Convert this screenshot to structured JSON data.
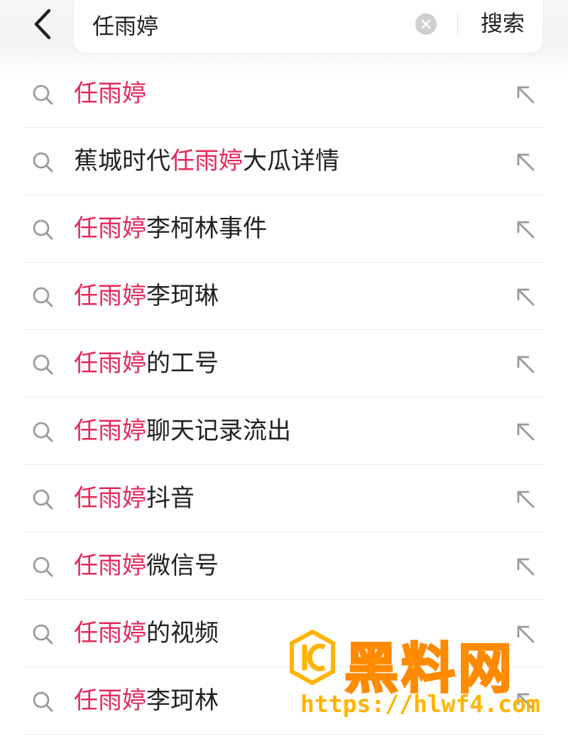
{
  "header": {
    "search_value": "任雨婷",
    "search_button_label": "搜索"
  },
  "suggestions": [
    {
      "before": "",
      "highlight": "任雨婷",
      "after": ""
    },
    {
      "before": "蕉城时代",
      "highlight": "任雨婷",
      "after": "大瓜详情"
    },
    {
      "before": "",
      "highlight": "任雨婷",
      "after": "李柯林事件"
    },
    {
      "before": "",
      "highlight": "任雨婷",
      "after": "李珂琳"
    },
    {
      "before": "",
      "highlight": "任雨婷",
      "after": "的工号"
    },
    {
      "before": "",
      "highlight": "任雨婷",
      "after": "聊天记录流出"
    },
    {
      "before": "",
      "highlight": "任雨婷",
      "after": "抖音"
    },
    {
      "before": "",
      "highlight": "任雨婷",
      "after": "微信号"
    },
    {
      "before": "",
      "highlight": "任雨婷",
      "after": "的视频"
    },
    {
      "before": "",
      "highlight": "任雨婷",
      "after": "李珂林"
    }
  ],
  "watermark": {
    "title": "黑料网",
    "url": "https://hlwf4.com"
  },
  "icons": {
    "back": "back-arrow-icon",
    "clear": "clear-icon",
    "suggestion": "search-icon",
    "fill": "fill-arrow-icon"
  },
  "colors": {
    "highlight": "#e5295a",
    "text": "#222222",
    "icon": "#9a9a9a",
    "watermark": "#ffb400"
  }
}
